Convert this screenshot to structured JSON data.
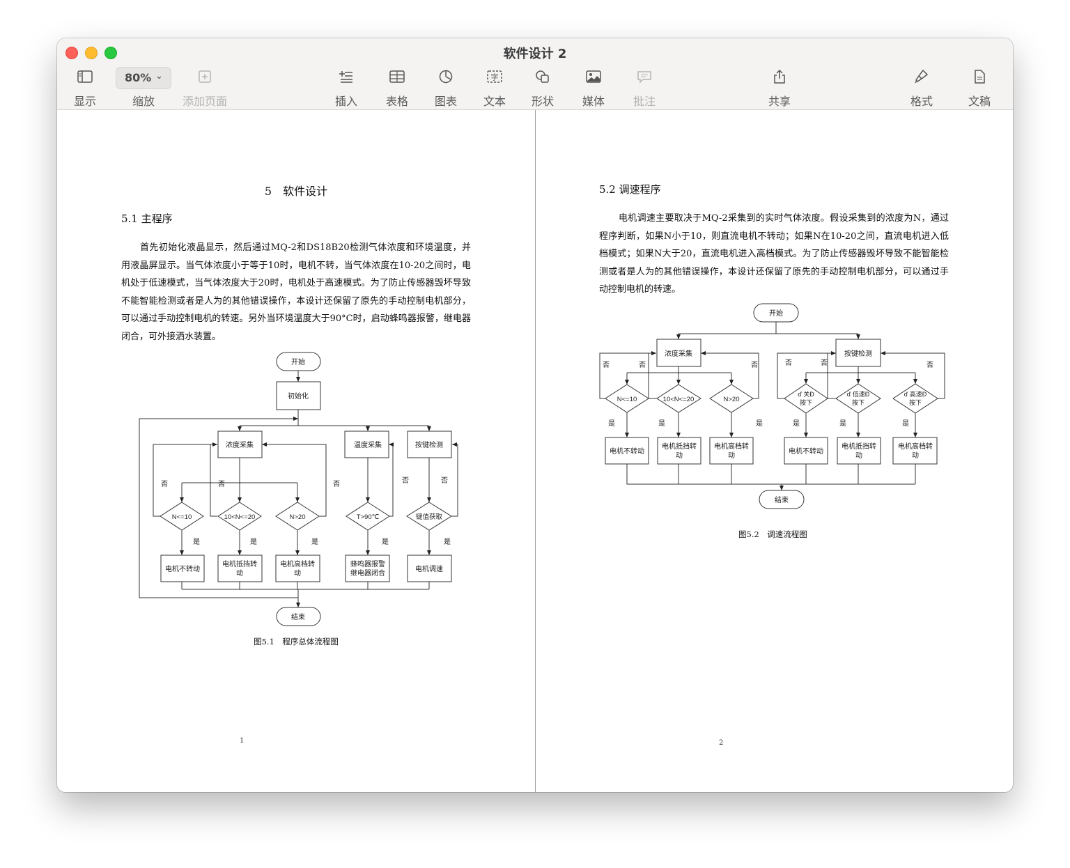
{
  "window": {
    "title": "软件设计 2"
  },
  "toolbar": {
    "view_label": "显示",
    "zoom_value": "80%",
    "zoom_label": "缩放",
    "add_page_label": "添加页面",
    "insert_label": "插入",
    "table_label": "表格",
    "chart_label": "图表",
    "text_label": "文本",
    "shape_label": "形状",
    "media_label": "媒体",
    "comment_label": "批注",
    "share_label": "共享",
    "format_label": "格式",
    "document_label": "文稿",
    "icons": [
      "sidebar-icon",
      "chevron-down-icon",
      "add-page-icon",
      "insert-list-icon",
      "table-icon",
      "chart-icon",
      "text-box-icon",
      "shape-icon",
      "media-icon",
      "comment-icon",
      "share-icon",
      "format-brush-icon",
      "document-icon"
    ]
  },
  "page1": {
    "chapter_title": "5　软件设计",
    "section_title": "5.1 主程序",
    "paragraph": "首先初始化液晶显示，然后通过MQ-2和DS18B20检测气体浓度和环境温度，并用液晶屏显示。当气体浓度小于等于10时，电机不转，当气体浓度在10-20之间时，电机处于低速模式，当气体浓度大于20时，电机处于高速模式。为了防止传感器毁坏导致不能智能检测或者是人为的其他错误操作，本设计还保留了原先的手动控制电机部分，可以通过手动控制电机的转速。另外当环境温度大于90°C时，启动蜂鸣器报警，继电器闭合，可外接洒水装置。",
    "figure_caption": "图5.1　程序总体流程图",
    "page_number": "1",
    "flowchart": {
      "start": "开始",
      "init": "初始化",
      "gas_sample": "浓度采集",
      "temp_sample": "温度采集",
      "key_detect": "按键检测",
      "d1": "N<=10",
      "d2": "10<N<=20",
      "d3": "N>20",
      "d4": "T>90℃",
      "d5": "键值获取",
      "a1": "电机不转动",
      "a2_l1": "电机抵挡转",
      "a2_l2": "动",
      "a3_l1": "电机高档转",
      "a3_l2": "动",
      "a4_l1": "蜂鸣器报警",
      "a4_l2": "继电器闭合",
      "a5": "电机调速",
      "yes": "是",
      "no": "否",
      "end": "结束"
    }
  },
  "page2": {
    "section_title": "5.2 调速程序",
    "paragraph": "电机调速主要取决于MQ-2采集到的实时气体浓度。假设采集到的浓度为N，通过程序判断，如果N小于10，则直流电机不转动；如果N在10-20之间，直流电机进入低档模式；如果N大于20，直流电机进入高档模式。为了防止传感器毁坏导致不能智能检测或者是人为的其他错误操作，本设计还保留了原先的手动控制电机部分，可以通过手动控制电机的转速。",
    "figure_caption": "图5.2　调速流程图",
    "page_number": "2",
    "flowchart": {
      "start": "开始",
      "gas_sample": "浓度采集",
      "key_detect": "按键检测",
      "d1": "N<=10",
      "d2": "10<N<=20",
      "d3": "N>20",
      "k1_l1": "ď 关Ð",
      "k1_l2": "按下",
      "k2_l1": "ď 低速Ð",
      "k2_l2": "按下",
      "k3_l1": "ď 高速Ð",
      "k3_l2": "按下",
      "a1": "电机不转动",
      "a2_l1": "电机抵挡转",
      "a2_l2": "动",
      "a3_l1": "电机高档转",
      "a3_l2": "动",
      "a4": "电机不转动",
      "a5_l1": "电机抵挡转",
      "a5_l2": "动",
      "a6_l1": "电机高档转",
      "a6_l2": "动",
      "yes": "是",
      "no": "否",
      "end": "结束"
    }
  }
}
